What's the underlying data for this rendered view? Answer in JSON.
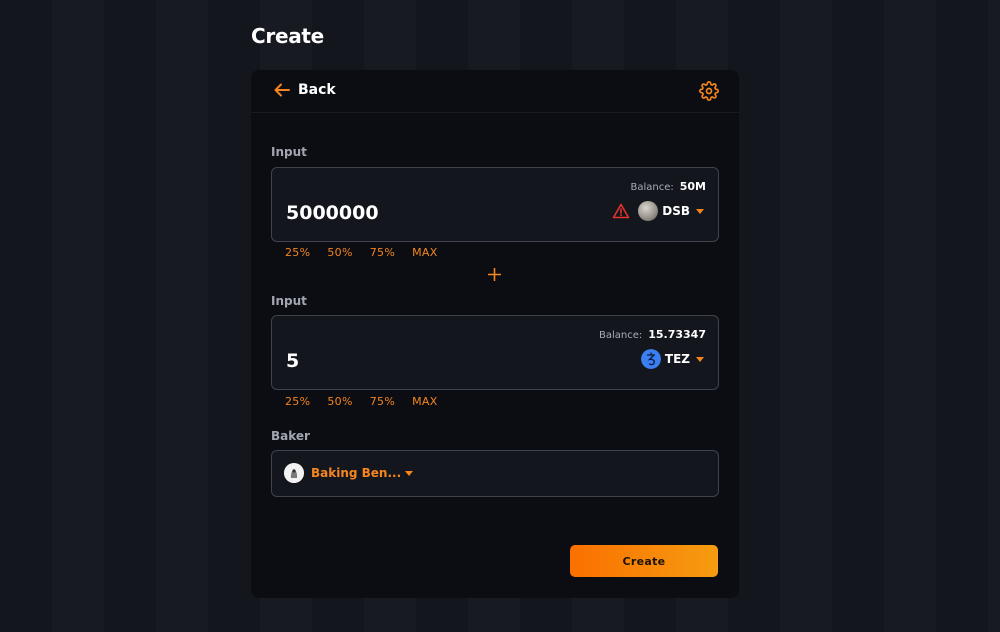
{
  "page": {
    "title": "Create"
  },
  "header": {
    "back_label": "Back"
  },
  "input1": {
    "label": "Input",
    "balance_label": "Balance:",
    "balance_value": "50M",
    "amount": "5000000",
    "token": "DSB",
    "percent_options": [
      "25%",
      "50%",
      "75%",
      "MAX"
    ]
  },
  "input2": {
    "label": "Input",
    "balance_label": "Balance:",
    "balance_value": "15.73347",
    "amount": "5",
    "token": "TEZ",
    "percent_options": [
      "25%",
      "50%",
      "75%",
      "MAX"
    ]
  },
  "baker": {
    "label": "Baker",
    "name": "Baking Ben..."
  },
  "actions": {
    "create_label": "Create"
  },
  "colors": {
    "accent": "#f5851f",
    "warning": "#e5322d",
    "tez_blue": "#3c7ff0"
  },
  "icons": {
    "back": "arrow-left-icon",
    "settings": "gear-icon",
    "warning": "warning-triangle-icon",
    "plus": "plus-icon",
    "dropdown": "chevron-down-icon"
  }
}
